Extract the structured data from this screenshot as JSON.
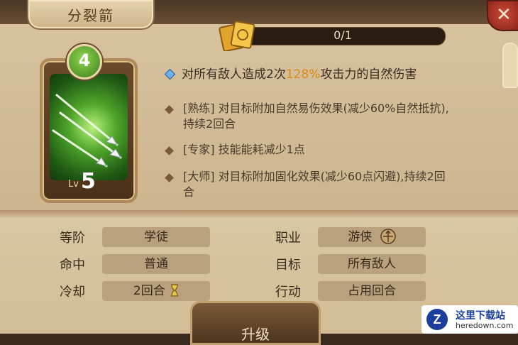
{
  "skill": {
    "name": "分裂箭",
    "cost": "4",
    "level_label": "Lv",
    "level": "5"
  },
  "progress": {
    "text": "0/1",
    "value": 0,
    "max": 1,
    "fraction": 0
  },
  "effects": {
    "main": {
      "before": "对所有敌人造成2次",
      "highlight": "128%",
      "after": "攻击力的自然伤害"
    },
    "lines": [
      {
        "l1": "[熟练] 对目标附加自然易伤效果(减少60%自然抵抗),",
        "l2": "持续2回合"
      },
      {
        "l1": "[专家] 技能能耗减少1点",
        "l2": ""
      },
      {
        "l1": "[大师] 对目标附加固化效果(减少60点闪避),持续2回",
        "l2": "合"
      }
    ]
  },
  "stats": {
    "rank": {
      "label": "等阶",
      "value": "学徒"
    },
    "hit": {
      "label": "命中",
      "value": "普通"
    },
    "cooldown": {
      "label": "冷却",
      "value": "2回合"
    },
    "job": {
      "label": "职业",
      "value": "游侠"
    },
    "target": {
      "label": "目标",
      "value": "所有敌人"
    },
    "action": {
      "label": "行动",
      "value": "占用回合"
    }
  },
  "upgrade_label": "升级",
  "watermark": {
    "title": "这里下载站",
    "url": "heredown.com"
  },
  "icons": [
    "card-scroll-icon",
    "close-icon",
    "ranger-class-icon",
    "hourglass-icon",
    "arrows-art-icon",
    "key-ornament-icon"
  ],
  "colors": {
    "highlight": "#d98a1a",
    "accent_green": "#7ec23a",
    "close_red": "#c94a3a"
  }
}
